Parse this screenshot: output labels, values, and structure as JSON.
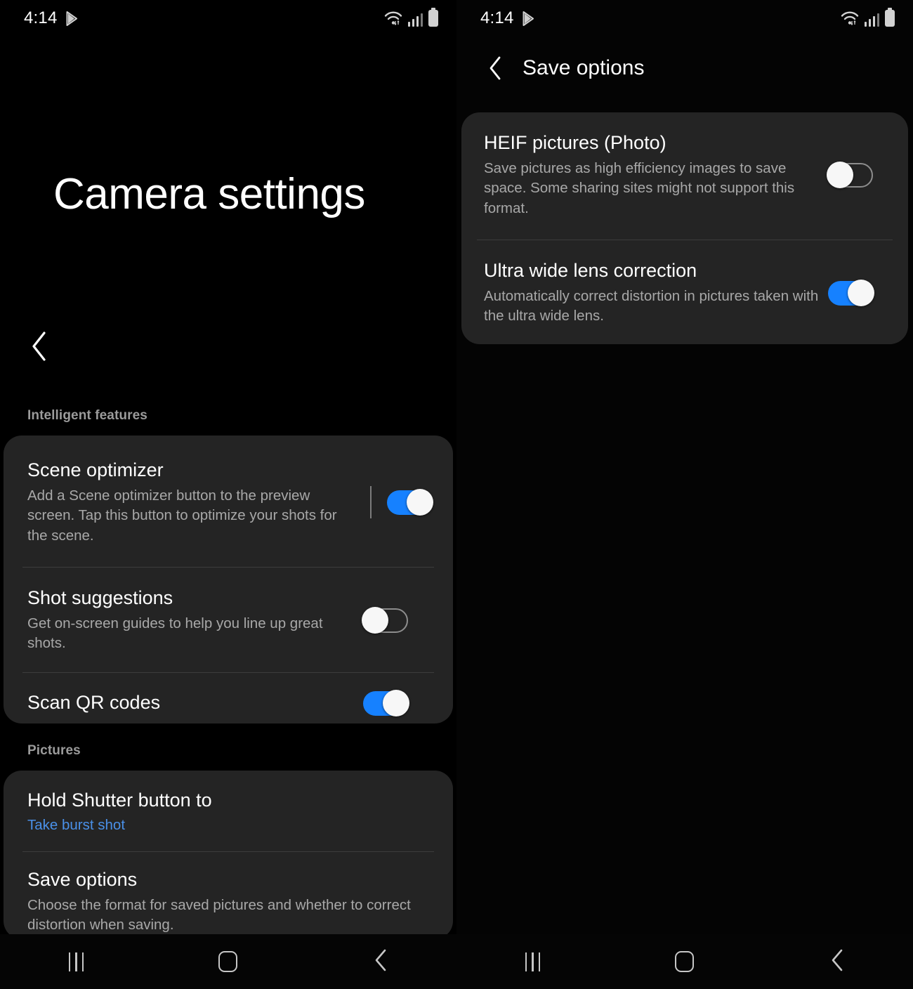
{
  "status_bar": {
    "time": "4:14",
    "icons": [
      "play-store-icon",
      "wifi-icon",
      "signal-icon",
      "battery-icon"
    ]
  },
  "left_screen": {
    "page_title": "Camera settings",
    "back_icon": "chevron-left-icon",
    "sections": [
      {
        "label": "Intelligent features",
        "items": [
          {
            "title": "Scene optimizer",
            "desc": "Add a Scene optimizer button to the preview screen. Tap this button to optimize your shots for the scene.",
            "control": "toggle",
            "state": "on"
          },
          {
            "title": "Shot suggestions",
            "desc": "Get on-screen guides to help you line up great shots.",
            "control": "toggle",
            "state": "off"
          },
          {
            "title": "Scan QR codes",
            "desc": "",
            "control": "toggle",
            "state": "on"
          }
        ]
      },
      {
        "label": "Pictures",
        "items": [
          {
            "title": "Hold Shutter button to",
            "value": "Take burst shot",
            "control": "none"
          },
          {
            "title": "Save options",
            "desc": "Choose the format for saved pictures and whether to correct distortion when saving.",
            "control": "none"
          }
        ]
      }
    ]
  },
  "right_screen": {
    "header": {
      "back_icon": "chevron-left-icon",
      "title": "Save options"
    },
    "items": [
      {
        "title": "HEIF pictures (Photo)",
        "desc": "Save pictures as high efficiency images to save space. Some sharing sites might not support this format.",
        "control": "toggle",
        "state": "off"
      },
      {
        "title": "Ultra wide lens correction",
        "desc": "Automatically correct distortion in pictures taken with the ultra wide lens.",
        "control": "toggle",
        "state": "on"
      }
    ]
  },
  "nav_bar": {
    "recents_label": "recents-icon",
    "home_label": "home-icon",
    "back_label": "back-icon"
  },
  "colors": {
    "accent": "#1681ff",
    "link": "#4a90e8",
    "card": "#242424",
    "background": "#000000",
    "secondary_text": "#a8a8a8",
    "section_label": "#9b9b9b"
  }
}
